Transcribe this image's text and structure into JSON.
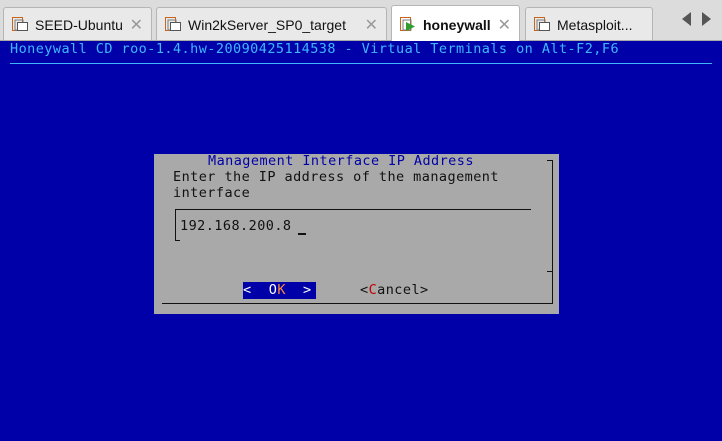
{
  "tabs": [
    {
      "label": "SEED-Ubuntu",
      "active": false,
      "icon": "vm-icon"
    },
    {
      "label": "Win2kServer_SP0_target",
      "active": false,
      "icon": "vm-icon"
    },
    {
      "label": "honeywall",
      "active": true,
      "icon": "vm-running-icon"
    },
    {
      "label": "Metasploit...",
      "active": false,
      "icon": "vm-icon"
    }
  ],
  "tab_close_glyph": "✕",
  "nav": {
    "prev_icon": "chevron-left-icon",
    "next_icon": "chevron-right-icon"
  },
  "terminal": {
    "title": "Honeywall CD roo-1.4.hw-20090425114538 - Virtual Terminals on Alt-F2,F6"
  },
  "dialog": {
    "title": "Management Interface IP Address",
    "prompt": "Enter the IP address of the management\ninterface",
    "input_value": "192.168.200.8",
    "ok": {
      "left": "<  ",
      "hot": "O",
      "key": "K",
      "right": "  >"
    },
    "cancel": {
      "left": "<",
      "hot": "C",
      "rest": "ancel",
      "right": ">"
    }
  },
  "colors": {
    "screen_bg": "#0000a8",
    "title_fg": "#3fb7ff",
    "dialog_bg": "#a9a9a9",
    "ok_hotkey": "#ff8a3a",
    "cancel_hotkey": "#c00000"
  }
}
